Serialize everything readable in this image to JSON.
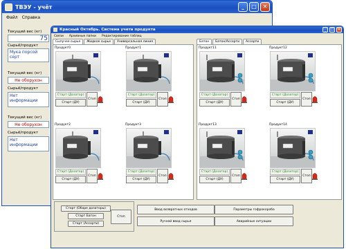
{
  "back_window": {
    "title": "ТВЭУ - учёт",
    "menu": [
      "Файл",
      "Справка"
    ],
    "weight_label_1": "Текущий вес (кг)",
    "weight_value_1": "75",
    "product_label_1": "Сырьё/продукт",
    "product_value_1": "Мука порсой серт",
    "weight_label_2": "Текущий вес (кг)",
    "status_2": "Не оборухон",
    "product_label_2": "Сырьё/продукт",
    "product_value_2": "Нет информации",
    "weight_label_3": "Текущий вес (кг)",
    "status_3": "Не оборухон",
    "product_label_3": "Сырьё/продукт",
    "product_value_3": "Нет информации"
  },
  "front_window": {
    "title": "Красный Октябрь. Система учета продукта",
    "menu": [
      "Связи",
      "Архивные папки",
      "Редактирование таблиц"
    ],
    "left_tabs": [
      "Сыпучее сырье",
      "Жидкое сырье",
      "Универсальная линия"
    ],
    "right_tabs": [
      "Батон",
      "Батон/Ассорти",
      "Ассорти"
    ],
    "cells": [
      {
        "label": "Продукт0",
        "start_dozer": "Старт (Дозатор)",
        "start_du": "Старт (ДУ)",
        "stop": "Стоп"
      },
      {
        "label": "Продукт1",
        "start_dozer": "Старт (Дозатор)",
        "start_du": "Старт (ДУ)",
        "stop": "Стоп"
      },
      {
        "label": "Продукт11",
        "start_dozer": "Старт (Дозатор)",
        "start_du": "Старт (ДУ)",
        "stop": "Стоп"
      },
      {
        "label": "Продукт12",
        "start_dozer": "Старт (Дозатор)",
        "start_du": "Старт (ДУ)",
        "stop": "Стоп"
      },
      {
        "label": "Продукт2",
        "start_dozer": "Старт (Дозатор)",
        "start_du": "Старт (ДУ)",
        "stop": "Стоп"
      },
      {
        "label": "Продукт3",
        "start_dozer": "Старт (Дозатор)",
        "start_du": "Старт (ДУ)",
        "stop": "Стоп"
      },
      {
        "label": "Продукт13",
        "start_dozer": "Старт (Дозатор)",
        "start_du": "Старт (ДУ)",
        "stop": "Стоп"
      },
      {
        "label": "Продукт14",
        "start_dozer": "Старт (Дозатор)",
        "start_du": "Старт (ДУ)",
        "stop": "Стоп"
      }
    ],
    "bottom": {
      "start_bread_assorti": "Старт (Обаре дозаторы)",
      "start_baton": "Старт Батон",
      "start_assorti": "Старт (Ассорти)",
      "stop": "Стоп",
      "manual_input_type": "Ввод возвратных отходов",
      "manual_input_raw": "Ручной ввод сырья",
      "params": "Параметры гофрокороба",
      "emergency": "Аварийные ситуации"
    }
  },
  "colors": {
    "title_bar": "#1a4fbf",
    "status_red": "#c00000",
    "weight_blue": "#1c3fa0",
    "start_green": "#2a8a2a"
  }
}
